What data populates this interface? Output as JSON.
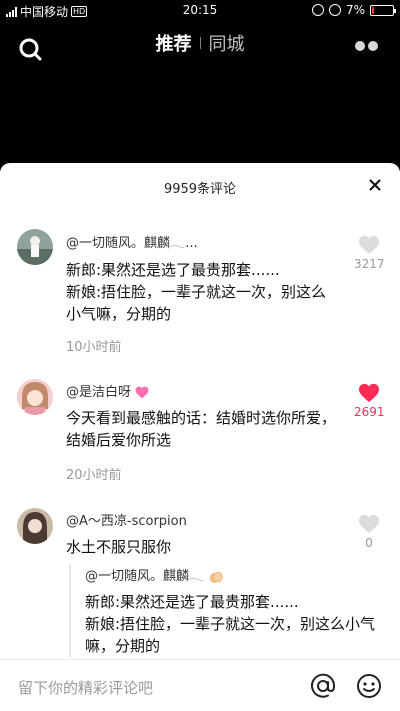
{
  "status_bar": {
    "carrier": "中国移动",
    "hd": "HD",
    "time": "20:15",
    "battery_percent": "7%",
    "battery_level": 0.07
  },
  "nav": {
    "tabs": [
      {
        "label": "推荐",
        "active": true
      },
      {
        "label": "同城",
        "active": false
      }
    ]
  },
  "comments_panel": {
    "title": "9959条评论",
    "comments": [
      {
        "user": "@一切随风。麒麟𓂃...",
        "text": "新郎:果然还是选了最贵那套......\n新娘:捂住脸，一辈子就这一次，别这么小气嘛，分期的",
        "time": "10小时前",
        "likes": "3217",
        "liked": false
      },
      {
        "user": "@是洁白呀",
        "user_emoji": "sparkling-heart",
        "text": "今天看到最感触的话：结婚时选你所爱，结婚后爱你所选",
        "time": "20小时前",
        "likes": "2691",
        "liked": true
      },
      {
        "user": "@A～西凉-scorpion",
        "text": "水土不服只服你",
        "likes": "0",
        "liked": false,
        "reply": {
          "user": "@一切随风。麒麟𓂃",
          "user_emoji": "clapping-hands",
          "text": "新郎:果然还是选了最贵那套......\n新娘:捂住脸，一辈子就这一次，别这么小气嘛，分期的"
        }
      }
    ]
  },
  "input_bar": {
    "placeholder": "留下你的精彩评论吧"
  },
  "colors": {
    "accent": "#fe2c55",
    "muted": "#999999"
  }
}
